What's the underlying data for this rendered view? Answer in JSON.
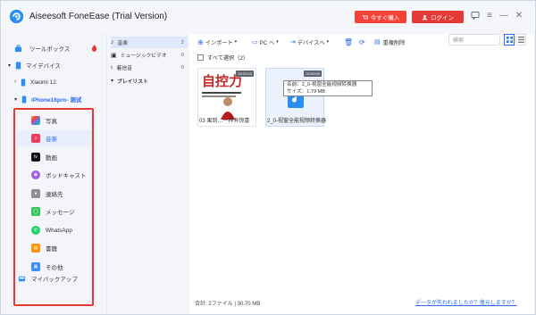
{
  "titlebar": {
    "app_title": "Aiseesoft FoneEase (Trial Version)",
    "buy_label": "今すぐ購入",
    "login_label": "ログイン"
  },
  "sidebar": {
    "toolbox": "ツールボックス",
    "my_devices": "マイデバイス",
    "device_xiaomi": "Xiaomi 12",
    "device_iphone": "iPhone16pro- 测试",
    "categories": [
      {
        "label": "写真",
        "icon": "photos-icon",
        "color": "#f6a623"
      },
      {
        "label": "音楽",
        "icon": "music-icon",
        "color": "#f03a5f"
      },
      {
        "label": "動画",
        "icon": "tv-icon",
        "color": "#111111"
      },
      {
        "label": "ポッドキャスト",
        "icon": "podcast-icon",
        "color": "#a45ee5"
      },
      {
        "label": "連絡先",
        "icon": "contacts-icon",
        "color": "#8e8e93"
      },
      {
        "label": "メッセージ",
        "icon": "messages-icon",
        "color": "#34c759"
      },
      {
        "label": "WhatsApp",
        "icon": "whatsapp-icon",
        "color": "#25d366"
      },
      {
        "label": "書籍",
        "icon": "books-icon",
        "color": "#ff9500"
      },
      {
        "label": "その他",
        "icon": "other-icon",
        "color": "#3a8ef6"
      }
    ],
    "my_backup": "マイバックアップ"
  },
  "midpanel": {
    "items": [
      {
        "label": "音楽",
        "count": "2",
        "icon": "music-note-icon"
      },
      {
        "label": "ミュージックビデオ",
        "count": "0",
        "icon": "music-video-icon"
      },
      {
        "label": "着信音",
        "count": "0",
        "icon": "bell-icon"
      }
    ],
    "playlist": "プレイリスト"
  },
  "toolbar": {
    "import": "インポート",
    "pc": "PC へ",
    "device": "デバイスへ",
    "dedupe": "重複削除",
    "search_placeholder": "検索"
  },
  "content": {
    "select_all": "すべて選択（2）",
    "cards": [
      {
        "name": "03 果到…一样有惊喜",
        "cover_text": "自控力",
        "badge": "00:00:00"
      },
      {
        "name": "2_0-视窗全能视频转换器",
        "badge": "00:00:00"
      }
    ],
    "tooltip_name": "名前：2_0-视窗全能视频转换器",
    "tooltip_size": "サイズ：1.79 MB",
    "total": "合計: 2ファイル | 30.70 MB",
    "lost_link": "データが失われましたか？復元しますか？"
  },
  "colors": {
    "accent": "#2c6cf0",
    "red": "#e53935"
  }
}
